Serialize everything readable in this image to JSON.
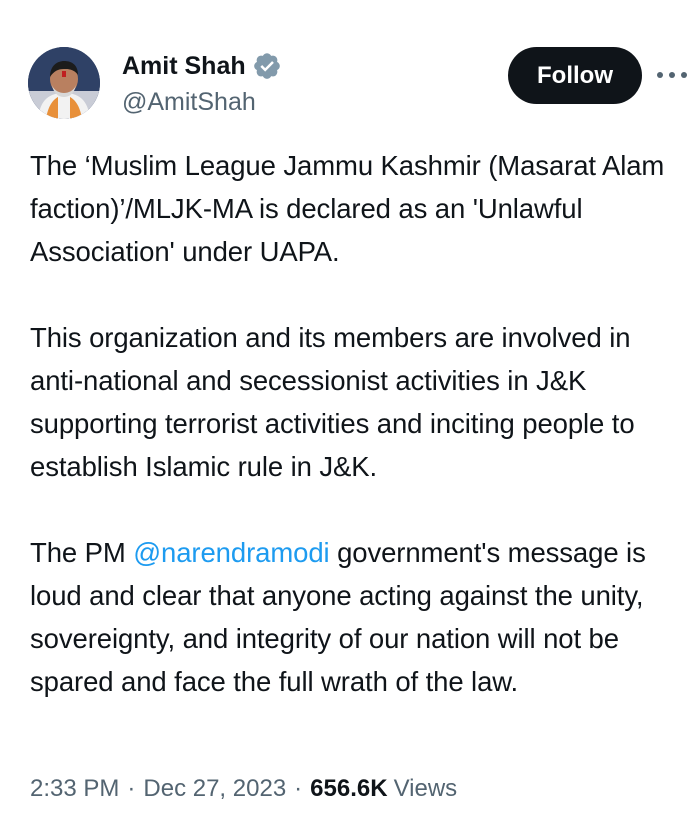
{
  "author": {
    "display_name": "Amit Shah",
    "handle": "@AmitShah",
    "verified_icon": "verified-badge-icon",
    "avatar_icon": "profile-photo"
  },
  "follow_button": {
    "label": "Follow"
  },
  "more_menu": {
    "icon": "more-horizontal-icon"
  },
  "tweet": {
    "paragraph_1": "The ‘Muslim League Jammu Kashmir (Masarat Alam faction)’/MLJK-MA is declared as an 'Unlawful Association' under UAPA.",
    "paragraph_2": "This organization and its members are involved in anti-national and secessionist activities in J&K supporting terrorist activities and inciting people to establish Islamic rule in J&K.",
    "paragraph_3_prefix": "The PM ",
    "paragraph_3_mention": "@narendramodi",
    "paragraph_3_suffix": " government's message is loud and clear that anyone acting against the unity, sovereignty, and integrity of our nation will not be spared and face the full wrath of the law."
  },
  "meta": {
    "time": "2:33 PM",
    "separator": "·",
    "date": "Dec 27, 2023",
    "views_count": "656.6K",
    "views_label": "Views"
  },
  "colors": {
    "text": "#0f1419",
    "secondary": "#536471",
    "link": "#1d9bf0",
    "verified": "#829aab",
    "button_bg": "#0f1419"
  }
}
